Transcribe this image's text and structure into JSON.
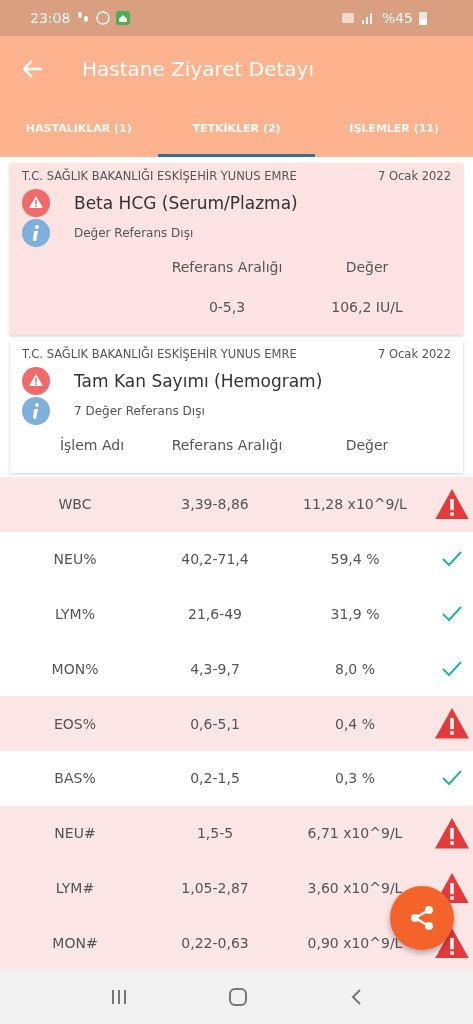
{
  "status_bar": {
    "time": "23:08",
    "battery": "%45"
  },
  "app_bar": {
    "title": "Hastane Ziyaret Detayı"
  },
  "tabs": [
    {
      "label": "HASTALIKLAR (1)",
      "selected": false
    },
    {
      "label": "TETKİKLER (2)",
      "selected": true
    },
    {
      "label": "İŞLEMLER (11)",
      "selected": false
    }
  ],
  "tests": [
    {
      "institution": "T.C. SAĞLIK BAKANLIĞI ESKİŞEHİR YUNUS EMRE",
      "date": "7 Ocak 2022",
      "name": "Beta HCG (Serum/Plazma)",
      "note": "Değer Referans Dışı",
      "highlighted": true,
      "columns": [
        "Referans Aralığı",
        "Değer"
      ],
      "rows": [
        {
          "range": "0-5,3",
          "value": "106,2 IU/L"
        }
      ]
    },
    {
      "institution": "T.C. SAĞLIK BAKANLIĞI ESKİŞEHİR YUNUS EMRE",
      "date": "7 Ocak 2022",
      "name": "Tam Kan Sayımı (Hemogram)",
      "note": "7 Değer Referans Dışı",
      "highlighted": false,
      "columns": [
        "İşlem Adı",
        "Referans Aralığı",
        "Değer"
      ]
    }
  ],
  "results": [
    {
      "name": "WBC",
      "range": "3,39-8,86",
      "value": "11,28 x10^9/L",
      "out_of_range": true
    },
    {
      "name": "NEU%",
      "range": "40,2-71,4",
      "value": "59,4 %",
      "out_of_range": false
    },
    {
      "name": "LYM%",
      "range": "21,6-49",
      "value": "31,9 %",
      "out_of_range": false
    },
    {
      "name": "MON%",
      "range": "4,3-9,7",
      "value": "8,0 %",
      "out_of_range": false
    },
    {
      "name": "EOS%",
      "range": "0,6-5,1",
      "value": "0,4 %",
      "out_of_range": true
    },
    {
      "name": "BAS%",
      "range": "0,2-1,5",
      "value": "0,3 %",
      "out_of_range": false
    },
    {
      "name": "NEU#",
      "range": "1,5-5",
      "value": "6,71 x10^9/L",
      "out_of_range": true
    },
    {
      "name": "LYM#",
      "range": "1,05-2,87",
      "value": "3,60 x10^9/L",
      "out_of_range": true
    },
    {
      "name": "MON#",
      "range": "0,22-0,63",
      "value": "0,90 x10^9/L",
      "out_of_range": true
    }
  ]
}
